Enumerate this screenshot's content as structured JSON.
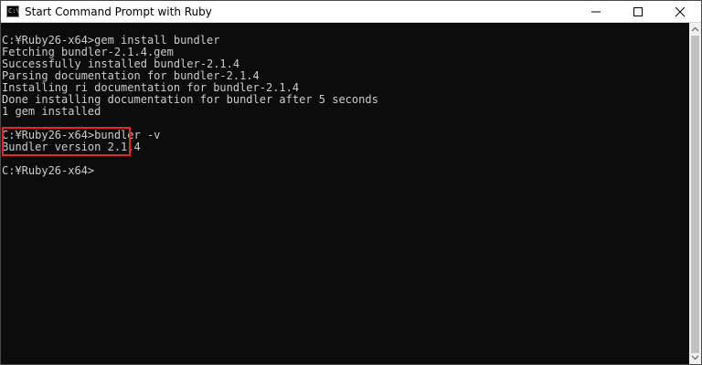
{
  "window": {
    "title": "Start Command Prompt with Ruby",
    "app_icon_text": "C:\\",
    "buttons": [
      "minimize",
      "maximize",
      "close"
    ]
  },
  "console": {
    "lines": [
      "C:¥Ruby26-x64>gem install bundler",
      "Fetching bundler-2.1.4.gem",
      "Successfully installed bundler-2.1.4",
      "Parsing documentation for bundler-2.1.4",
      "Installing ri documentation for bundler-2.1.4",
      "Done installing documentation for bundler after 5 seconds",
      "1 gem installed",
      "",
      "C:¥Ruby26-x64>bundler -v",
      "Bundler version 2.1.4",
      "",
      "C:¥Ruby26-x64>"
    ],
    "text_color": "#cccccc",
    "background": "#0c0c0c"
  },
  "annotation": {
    "color": "#e5252a"
  }
}
